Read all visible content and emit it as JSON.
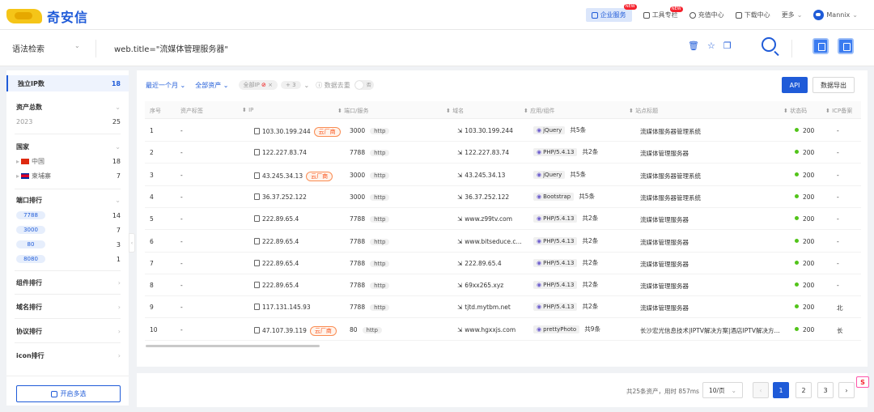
{
  "brand": {
    "logo_text": "奇安信"
  },
  "topnav": {
    "enterprise": "企业服务",
    "tools": "工具专栏",
    "recharge": "充值中心",
    "download": "下载中心",
    "more": "更多",
    "user": "Mannix",
    "new_badge": "NEW"
  },
  "search": {
    "syntax_label": "语法检索",
    "query": "web.title=\"流媒体管理服务器\""
  },
  "sidebar": {
    "unique_ip_label": "独立IP数",
    "unique_ip_value": "18",
    "assets_label": "资产总数",
    "assets_year": "2023",
    "assets_value": "25",
    "country_label": "国家",
    "countries": [
      {
        "name": "中国",
        "count": "18"
      },
      {
        "name": "柬埔寨",
        "count": "7"
      }
    ],
    "port_label": "端口排行",
    "ports": [
      {
        "port": "7788",
        "count": "14"
      },
      {
        "port": "3000",
        "count": "7"
      },
      {
        "port": "80",
        "count": "3"
      },
      {
        "port": "8080",
        "count": "1"
      }
    ],
    "component_rank": "组件排行",
    "domain_rank": "域名排行",
    "protocol_rank": "协议排行",
    "icon_rank": "icon排行",
    "multi_select": "开启多选"
  },
  "filters": {
    "time": "最近一个月",
    "scope": "全部资产",
    "tag_text": "全部IP",
    "tag_extra": "+ 3",
    "dedup_label": "数据去重",
    "toggle": "否",
    "api": "API",
    "export": "数据导出"
  },
  "table": {
    "headers": [
      "序号",
      "资产标签",
      "IP",
      "端口/服务",
      "域名",
      "应用/组件",
      "站点标题",
      "状态码",
      "ICP备案"
    ],
    "cloud_label": "云厂商",
    "rows": [
      {
        "no": "1",
        "tag": "-",
        "ip": "103.30.199.244",
        "cloud": true,
        "port": "3000",
        "proto": "http",
        "domain": "103.30.199.244",
        "comp": "jQuery",
        "comp_count": "共5条",
        "title": "流媒体服务器管理系统",
        "status": "200",
        "icp": "-"
      },
      {
        "no": "2",
        "tag": "-",
        "ip": "122.227.83.74",
        "cloud": false,
        "port": "7788",
        "proto": "http",
        "domain": "122.227.83.74",
        "comp": "PHP/5.4.13",
        "comp_count": "共2条",
        "title": "流媒体管理服务器",
        "status": "200",
        "icp": "-"
      },
      {
        "no": "3",
        "tag": "-",
        "ip": "43.245.34.13",
        "cloud": true,
        "port": "3000",
        "proto": "http",
        "domain": "43.245.34.13",
        "comp": "jQuery",
        "comp_count": "共5条",
        "title": "流媒体服务器管理系统",
        "status": "200",
        "icp": "-"
      },
      {
        "no": "4",
        "tag": "-",
        "ip": "36.37.252.122",
        "cloud": false,
        "port": "3000",
        "proto": "http",
        "domain": "36.37.252.122",
        "comp": "Bootstrap",
        "comp_count": "共5条",
        "title": "流媒体服务器管理系统",
        "status": "200",
        "icp": "-"
      },
      {
        "no": "5",
        "tag": "-",
        "ip": "222.89.65.4",
        "cloud": false,
        "port": "7788",
        "proto": "http",
        "domain": "www.z99tv.com",
        "comp": "PHP/5.4.13",
        "comp_count": "共2条",
        "title": "流媒体管理服务器",
        "status": "200",
        "icp": "-"
      },
      {
        "no": "6",
        "tag": "-",
        "ip": "222.89.65.4",
        "cloud": false,
        "port": "7788",
        "proto": "http",
        "domain": "www.bitseduce.c...",
        "comp": "PHP/5.4.13",
        "comp_count": "共2条",
        "title": "流媒体管理服务器",
        "status": "200",
        "icp": "-"
      },
      {
        "no": "7",
        "tag": "-",
        "ip": "222.89.65.4",
        "cloud": false,
        "port": "7788",
        "proto": "http",
        "domain": "222.89.65.4",
        "comp": "PHP/5.4.13",
        "comp_count": "共2条",
        "title": "流媒体管理服务器",
        "status": "200",
        "icp": "-"
      },
      {
        "no": "8",
        "tag": "-",
        "ip": "222.89.65.4",
        "cloud": false,
        "port": "7788",
        "proto": "http",
        "domain": "69xx265.xyz",
        "comp": "PHP/5.4.13",
        "comp_count": "共2条",
        "title": "流媒体管理服务器",
        "status": "200",
        "icp": "-"
      },
      {
        "no": "9",
        "tag": "-",
        "ip": "117.131.145.93",
        "cloud": false,
        "port": "7788",
        "proto": "http",
        "domain": "tjtd.mytbm.net",
        "comp": "PHP/5.4.13",
        "comp_count": "共2条",
        "title": "流媒体管理服务器",
        "status": "200",
        "icp": "北"
      },
      {
        "no": "10",
        "tag": "-",
        "ip": "47.107.39.119",
        "cloud": true,
        "port": "80",
        "proto": "http",
        "domain": "www.hgxxjs.com",
        "comp": "prettyPhoto",
        "comp_count": "共9条",
        "title": "长沙宏光信息技术|IPTV解决方案|酒店IPTV解决方...",
        "status": "200",
        "icp": "长"
      }
    ]
  },
  "pagination": {
    "summary": "共25条资产，用时 857ms",
    "page_size": "10/页",
    "pages": [
      "1",
      "2",
      "3"
    ]
  },
  "colors": {
    "accent": "#1f5bd8",
    "cloud": "#fa541c",
    "status_ok": "#52c41a"
  }
}
